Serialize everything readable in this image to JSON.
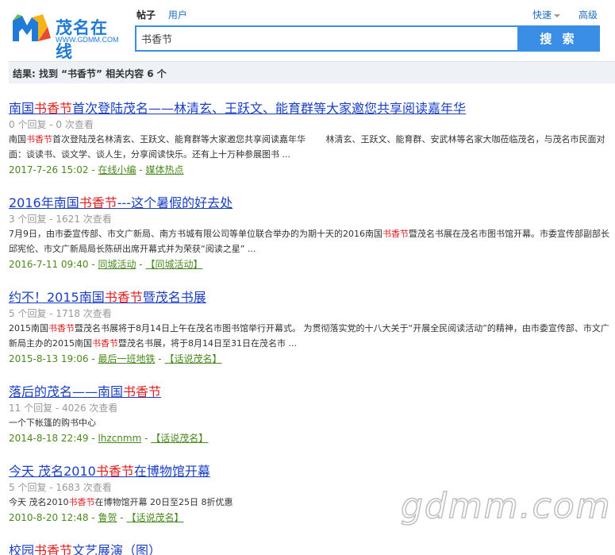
{
  "logo": {
    "text": "茂名在线",
    "url": "WWW.GDMM.COM"
  },
  "tabs": [
    {
      "label": "帖子",
      "active": true
    },
    {
      "label": "用户",
      "active": false
    }
  ],
  "header_links": {
    "fast": "快速",
    "advanced": "高级"
  },
  "search": {
    "value": "书香节",
    "button_label": "搜 索"
  },
  "result_summary": "结果: 找到 “书香节” 相关内容 6 个",
  "colors": {
    "accent": "#3a8ee6",
    "link": "#1a3fc4",
    "highlight": "#e02020",
    "meta": "#4a8a1e"
  },
  "results": [
    {
      "title": {
        "before": "南国",
        "hl": "书香节",
        "after": "首次登陆茂名——林清玄、王跃文、能育群等大家邀您共享阅读嘉年华"
      },
      "stats": "0 个回复 - 0 次查看",
      "snippet": [
        {
          "text": "南国"
        },
        {
          "text": "书香节",
          "hl": true
        },
        {
          "text": "首次登陆茂名林清玄、王跃文、能育群等大家邀您共享阅读嘉年华 　　林清玄、王跃文、能育群、安武林等名家大咖莅临茂名，与茂名市民面对面：谈读书、谈文学、谈人生，分享阅读快乐。还有上十万种参展图书 ..."
        }
      ],
      "date": "2017-7-26 15:02",
      "author": "在线小编",
      "category": "媒体热点"
    },
    {
      "title": {
        "before": "2016年南国",
        "hl": "书香节",
        "after": "---这个暑假的好去处"
      },
      "stats": "3 个回复 - 1621 次查看",
      "snippet": [
        {
          "text": "7月9日，由市委宣传部、市文广新局、南方书城有限公司等单位联合举办的为期十天的2016南国"
        },
        {
          "text": "书香节",
          "hl": true
        },
        {
          "text": "暨茂名书展在茂名市图书馆开幕。市委宣传部副部长邱宪伦、市文广新局局长陈研出席开幕式并为荣获“阅读之星” ..."
        }
      ],
      "date": "2016-7-11 09:40",
      "author": "同城活动",
      "category": "【同城活动】"
    },
    {
      "title": {
        "before": "约不！2015南国",
        "hl": "书香节",
        "after": "暨茂名书展"
      },
      "stats": "5 个回复 - 1718 次查看",
      "snippet": [
        {
          "text": "2015南国"
        },
        {
          "text": "书香节",
          "hl": true
        },
        {
          "text": "暨茂名书展将于8月14日上午在茂名市图书馆举行开幕式。 为贯彻落实党的十八大关于“开展全民阅读活动”的精神，由市委宣传部、市文广新局主办的2015南国"
        },
        {
          "text": "书香节",
          "hl": true
        },
        {
          "text": "暨茂名书展，将于8月14日至31日在茂名市 ..."
        }
      ],
      "date": "2015-8-13 19:06",
      "author": "最后一班地铁",
      "category": "【话说茂名】"
    },
    {
      "title": {
        "before": "落后的茂名——南国",
        "hl": "书香节",
        "after": ""
      },
      "stats": "11 个回复 - 4026 次查看",
      "snippet": [
        {
          "text": "一个下帐篷的购书中心"
        }
      ],
      "date": "2014-8-18 22:49",
      "author": "lhzcnmm",
      "category": "【话说茂名】"
    },
    {
      "title": {
        "before": "今天 茂名2010",
        "hl": "书香节",
        "after": "在博物馆开幕"
      },
      "stats": "5 个回复 - 1683 次查看",
      "snippet": [
        {
          "text": "今天 茂名2010"
        },
        {
          "text": "书香节",
          "hl": true
        },
        {
          "text": "在博物馆开幕 20日至25日 8折优惠"
        }
      ],
      "date": "2010-8-20 12:48",
      "author": "鲁贺",
      "category": "【话说茂名】"
    },
    {
      "title": {
        "before": "校园",
        "hl": "书香节",
        "after": "文艺展演（图）"
      },
      "stats": "",
      "snippet": [],
      "date": "",
      "author": "",
      "category": ""
    }
  ],
  "watermark": "gdmm.com"
}
